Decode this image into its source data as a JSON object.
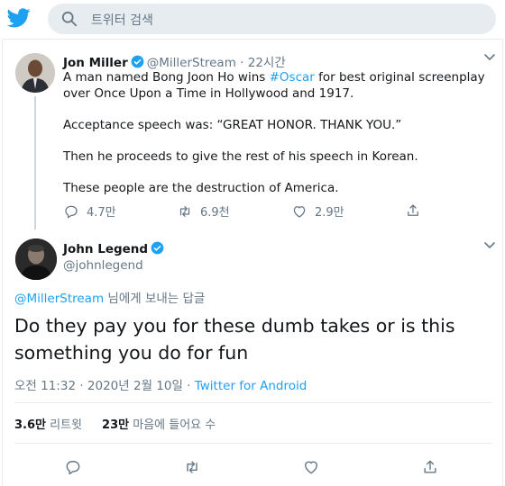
{
  "search": {
    "placeholder": "트위터 검색"
  },
  "tweet1": {
    "name": "Jon Miller",
    "handle": "@MillerStream",
    "time": "· 22시간",
    "body_line1_pre": "A man named Bong Joon Ho wins ",
    "hashtag": "#Oscar",
    "body_line1_post": " for best original screenplay",
    "body_line2": "over Once Upon a Time in Hollywood and 1917.",
    "body_p2": "Acceptance speech was: “GREAT HONOR. THANK YOU.”",
    "body_p3": "Then he proceeds to give the rest of his speech in Korean.",
    "body_p4": "These people are the destruction of America.",
    "replies": "4.7만",
    "retweets": "6.9천",
    "likes": "2.9만"
  },
  "tweet2": {
    "name": "John Legend",
    "handle": "@johnlegend",
    "replying_mention": "@MillerStream",
    "replying_suffix": " 님에게 보내는 답글",
    "text": "Do they pay you for these dumb takes or is this something you do for fun",
    "timestamp": "오전 11:32 · 2020년 2월 10일 · ",
    "source": "Twitter for Android",
    "retweet_count": "3.6만",
    "retweet_label": "리트윗",
    "like_count": "23만",
    "like_label": "마음에 들어요 수"
  },
  "colors": {
    "brand": "#1da1f2",
    "muted": "#657786",
    "text": "#14171a"
  }
}
